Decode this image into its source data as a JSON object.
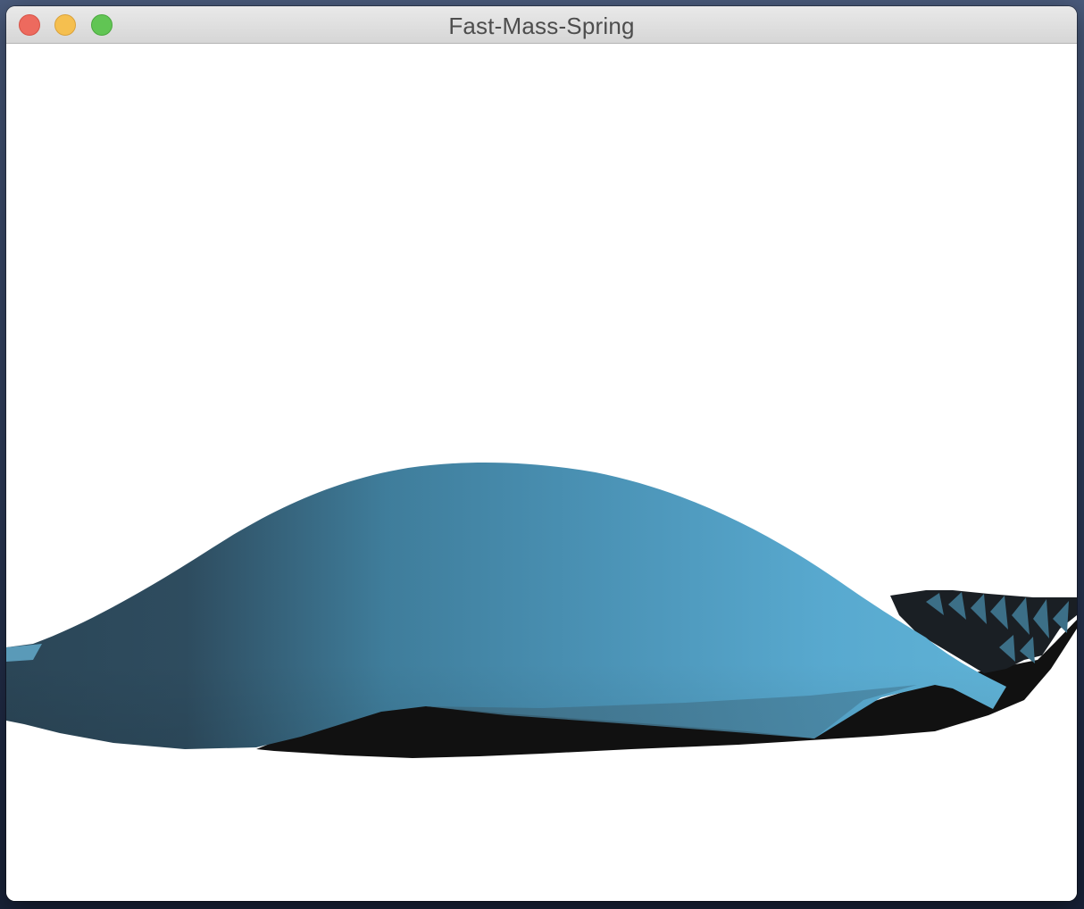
{
  "window": {
    "title": "Fast-Mass-Spring",
    "controls": {
      "close": "close-button",
      "minimize": "minimize-button",
      "zoom": "zoom-button"
    }
  },
  "scene": {
    "background_color": "#ffffff",
    "cloth_color": "#53a6cc",
    "shadow_color": "#222b33",
    "underside_color": "#111111"
  }
}
